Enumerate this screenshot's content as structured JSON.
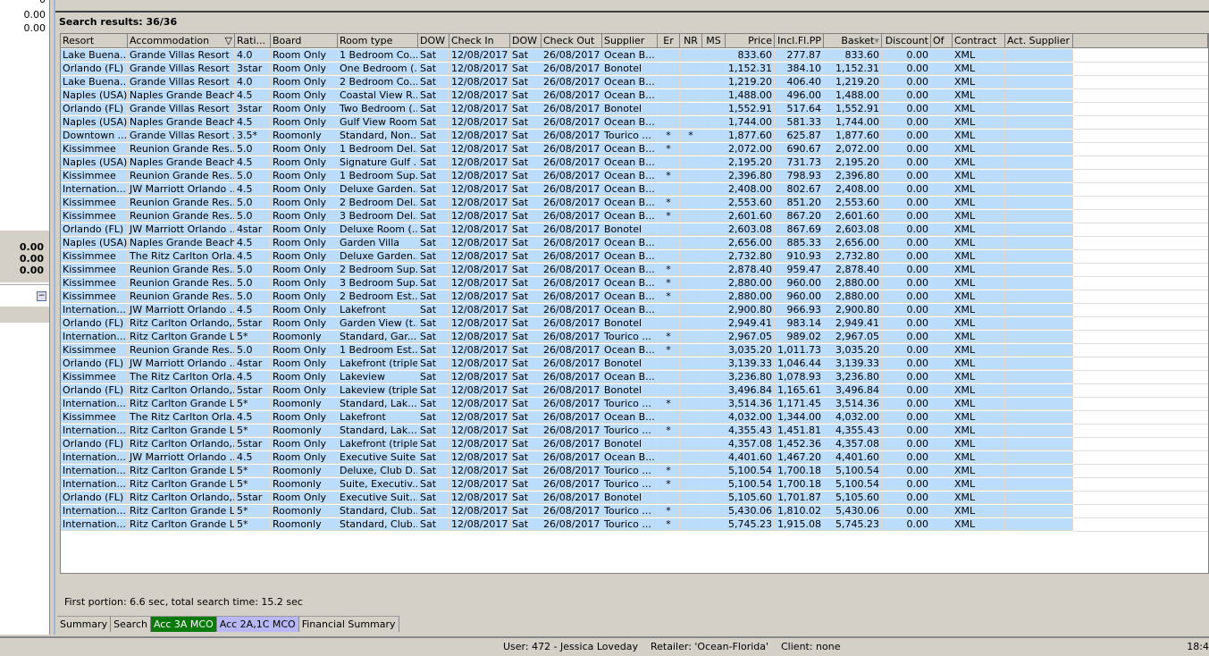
{
  "left_panel": {
    "top_values": [
      "0",
      "0.00",
      "0.00"
    ],
    "totals": [
      "0.00",
      "0.00",
      "0.00"
    ]
  },
  "results_title": "Search results: 36/36",
  "columns": [
    "Resort",
    "Accommodation",
    "Rati...",
    "Board",
    "Room type",
    "DOW",
    "Check In",
    "DOW",
    "Check Out",
    "Supplier",
    "Er",
    "NR",
    "MS",
    "Price",
    "Incl.Fl.PP",
    "Basket",
    "Discount",
    "Of",
    "Contract",
    "Act. Supplier"
  ],
  "rows": [
    [
      "Lake Buena...",
      "Grande Villas Resort",
      "4.0",
      "Room Only",
      "1 Bedroom Co...",
      "Sat",
      "12/08/2017",
      "Sat",
      "26/08/2017",
      "Ocean B...",
      "",
      "",
      "",
      "833.60",
      "277.87",
      "833.60",
      "0.00",
      "",
      "XML",
      ""
    ],
    [
      "Orlando (FL)",
      "Grande Villas Resort",
      "3star",
      "Room Only",
      "One Bedroom (...",
      "Sat",
      "12/08/2017",
      "Sat",
      "26/08/2017",
      "Bonotel",
      "",
      "",
      "",
      "1,152.31",
      "384.10",
      "1,152.31",
      "0.00",
      "",
      "XML",
      ""
    ],
    [
      "Lake Buena...",
      "Grande Villas Resort",
      "4.0",
      "Room Only",
      "2 Bedroom Co...",
      "Sat",
      "12/08/2017",
      "Sat",
      "26/08/2017",
      "Ocean B...",
      "",
      "",
      "",
      "1,219.20",
      "406.40",
      "1,219.20",
      "0.00",
      "",
      "XML",
      ""
    ],
    [
      "Naples (USA)",
      "Naples Grande Beach...",
      "4.5",
      "Room Only",
      "Coastal View R...",
      "Sat",
      "12/08/2017",
      "Sat",
      "26/08/2017",
      "Ocean B...",
      "",
      "",
      "",
      "1,488.00",
      "496.00",
      "1,488.00",
      "0.00",
      "",
      "XML",
      ""
    ],
    [
      "Orlando (FL)",
      "Grande Villas Resort",
      "3star",
      "Room Only",
      "Two Bedroom (...",
      "Sat",
      "12/08/2017",
      "Sat",
      "26/08/2017",
      "Bonotel",
      "",
      "",
      "",
      "1,552.91",
      "517.64",
      "1,552.91",
      "0.00",
      "",
      "XML",
      ""
    ],
    [
      "Naples (USA)",
      "Naples Grande Beach...",
      "4.5",
      "Room Only",
      "Gulf View Room",
      "Sat",
      "12/08/2017",
      "Sat",
      "26/08/2017",
      "Ocean B...",
      "",
      "",
      "",
      "1,744.00",
      "581.33",
      "1,744.00",
      "0.00",
      "",
      "XML",
      ""
    ],
    [
      "Downtown ...",
      "Grande Villas Resort ...",
      "3.5*",
      "Roomonly",
      "Standard, Non...",
      "Sat",
      "12/08/2017",
      "Sat",
      "26/08/2017",
      "Tourico ...",
      "*",
      "*",
      "",
      "1,877.60",
      "625.87",
      "1,877.60",
      "0.00",
      "",
      "XML",
      ""
    ],
    [
      "Kissimmee",
      "Reunion Grande Res...",
      "5.0",
      "Room Only",
      "1 Bedroom Del...",
      "Sat",
      "12/08/2017",
      "Sat",
      "26/08/2017",
      "Ocean B...",
      "*",
      "",
      "",
      "2,072.00",
      "690.67",
      "2,072.00",
      "0.00",
      "",
      "XML",
      ""
    ],
    [
      "Naples (USA)",
      "Naples Grande Beach...",
      "4.5",
      "Room Only",
      "Signature Gulf ...",
      "Sat",
      "12/08/2017",
      "Sat",
      "26/08/2017",
      "Ocean B...",
      "",
      "",
      "",
      "2,195.20",
      "731.73",
      "2,195.20",
      "0.00",
      "",
      "XML",
      ""
    ],
    [
      "Kissimmee",
      "Reunion Grande Res...",
      "5.0",
      "Room Only",
      "1 Bedroom Sup...",
      "Sat",
      "12/08/2017",
      "Sat",
      "26/08/2017",
      "Ocean B...",
      "*",
      "",
      "",
      "2,396.80",
      "798.93",
      "2,396.80",
      "0.00",
      "",
      "XML",
      ""
    ],
    [
      "Internation...",
      "JW Marriott Orlando ...",
      "4.5",
      "Room Only",
      "Deluxe Garden...",
      "Sat",
      "12/08/2017",
      "Sat",
      "26/08/2017",
      "Ocean B...",
      "",
      "",
      "",
      "2,408.00",
      "802.67",
      "2,408.00",
      "0.00",
      "",
      "XML",
      ""
    ],
    [
      "Kissimmee",
      "Reunion Grande Res...",
      "5.0",
      "Room Only",
      "2 Bedroom Del...",
      "Sat",
      "12/08/2017",
      "Sat",
      "26/08/2017",
      "Ocean B...",
      "*",
      "",
      "",
      "2,553.60",
      "851.20",
      "2,553.60",
      "0.00",
      "",
      "XML",
      ""
    ],
    [
      "Kissimmee",
      "Reunion Grande Res...",
      "5.0",
      "Room Only",
      "3 Bedroom Del...",
      "Sat",
      "12/08/2017",
      "Sat",
      "26/08/2017",
      "Ocean B...",
      "*",
      "",
      "",
      "2,601.60",
      "867.20",
      "2,601.60",
      "0.00",
      "",
      "XML",
      ""
    ],
    [
      "Orlando (FL)",
      "JW Marriott Orlando ...",
      "4star",
      "Room Only",
      "Deluxe Room (...",
      "Sat",
      "12/08/2017",
      "Sat",
      "26/08/2017",
      "Bonotel",
      "",
      "",
      "",
      "2,603.08",
      "867.69",
      "2,603.08",
      "0.00",
      "",
      "XML",
      ""
    ],
    [
      "Naples (USA)",
      "Naples Grande Beach...",
      "4.5",
      "Room Only",
      "Garden Villa",
      "Sat",
      "12/08/2017",
      "Sat",
      "26/08/2017",
      "Ocean B...",
      "",
      "",
      "",
      "2,656.00",
      "885.33",
      "2,656.00",
      "0.00",
      "",
      "XML",
      ""
    ],
    [
      "Kissimmee",
      "The Ritz Carlton Orla...",
      "4.5",
      "Room Only",
      "Deluxe Garden...",
      "Sat",
      "12/08/2017",
      "Sat",
      "26/08/2017",
      "Ocean B...",
      "",
      "",
      "",
      "2,732.80",
      "910.93",
      "2,732.80",
      "0.00",
      "",
      "XML",
      ""
    ],
    [
      "Kissimmee",
      "Reunion Grande Res...",
      "5.0",
      "Room Only",
      "2 Bedroom Sup...",
      "Sat",
      "12/08/2017",
      "Sat",
      "26/08/2017",
      "Ocean B...",
      "*",
      "",
      "",
      "2,878.40",
      "959.47",
      "2,878.40",
      "0.00",
      "",
      "XML",
      ""
    ],
    [
      "Kissimmee",
      "Reunion Grande Res...",
      "5.0",
      "Room Only",
      "3 Bedroom Sup...",
      "Sat",
      "12/08/2017",
      "Sat",
      "26/08/2017",
      "Ocean B...",
      "*",
      "",
      "",
      "2,880.00",
      "960.00",
      "2,880.00",
      "0.00",
      "",
      "XML",
      ""
    ],
    [
      "Kissimmee",
      "Reunion Grande Res...",
      "5.0",
      "Room Only",
      "2 Bedroom Est...",
      "Sat",
      "12/08/2017",
      "Sat",
      "26/08/2017",
      "Ocean B...",
      "*",
      "",
      "",
      "2,880.00",
      "960.00",
      "2,880.00",
      "0.00",
      "",
      "XML",
      ""
    ],
    [
      "Internation...",
      "JW Marriott Orlando ...",
      "4.5",
      "Room Only",
      "Lakefront",
      "Sat",
      "12/08/2017",
      "Sat",
      "26/08/2017",
      "Ocean B...",
      "",
      "",
      "",
      "2,900.80",
      "966.93",
      "2,900.80",
      "0.00",
      "",
      "XML",
      ""
    ],
    [
      "Orlando (FL)",
      "Ritz Carlton Orlando,...",
      "5star",
      "Room Only",
      "Garden View (t...",
      "Sat",
      "12/08/2017",
      "Sat",
      "26/08/2017",
      "Bonotel",
      "",
      "",
      "",
      "2,949.41",
      "983.14",
      "2,949.41",
      "0.00",
      "",
      "XML",
      ""
    ],
    [
      "Internation...",
      "Ritz Carlton Grande L...",
      "5*",
      "Roomonly",
      "Standard, Gar...",
      "Sat",
      "12/08/2017",
      "Sat",
      "26/08/2017",
      "Tourico ...",
      "*",
      "",
      "",
      "2,967.05",
      "989.02",
      "2,967.05",
      "0.00",
      "",
      "XML",
      ""
    ],
    [
      "Kissimmee",
      "Reunion Grande Res...",
      "5.0",
      "Room Only",
      "1 Bedroom Est...",
      "Sat",
      "12/08/2017",
      "Sat",
      "26/08/2017",
      "Ocean B...",
      "*",
      "",
      "",
      "3,035.20",
      "1,011.73",
      "3,035.20",
      "0.00",
      "",
      "XML",
      ""
    ],
    [
      "Orlando (FL)",
      "JW Marriott Orlando ...",
      "4star",
      "Room Only",
      "Lakefront (triple )",
      "Sat",
      "12/08/2017",
      "Sat",
      "26/08/2017",
      "Bonotel",
      "",
      "",
      "",
      "3,139.33",
      "1,046.44",
      "3,139.33",
      "0.00",
      "",
      "XML",
      ""
    ],
    [
      "Kissimmee",
      "The Ritz Carlton Orla...",
      "4.5",
      "Room Only",
      "Lakeview",
      "Sat",
      "12/08/2017",
      "Sat",
      "26/08/2017",
      "Ocean B...",
      "",
      "",
      "",
      "3,236.80",
      "1,078.93",
      "3,236.80",
      "0.00",
      "",
      "XML",
      ""
    ],
    [
      "Orlando (FL)",
      "Ritz Carlton Orlando,...",
      "5star",
      "Room Only",
      "Lakeview (triple )",
      "Sat",
      "12/08/2017",
      "Sat",
      "26/08/2017",
      "Bonotel",
      "",
      "",
      "",
      "3,496.84",
      "1,165.61",
      "3,496.84",
      "0.00",
      "",
      "XML",
      ""
    ],
    [
      "Internation...",
      "Ritz Carlton Grande L...",
      "5*",
      "Roomonly",
      "Standard, Lak...",
      "Sat",
      "12/08/2017",
      "Sat",
      "26/08/2017",
      "Tourico ...",
      "*",
      "",
      "",
      "3,514.36",
      "1,171.45",
      "3,514.36",
      "0.00",
      "",
      "XML",
      ""
    ],
    [
      "Kissimmee",
      "The Ritz Carlton Orla...",
      "4.5",
      "Room Only",
      "Lakefront",
      "Sat",
      "12/08/2017",
      "Sat",
      "26/08/2017",
      "Ocean B...",
      "",
      "",
      "",
      "4,032.00",
      "1,344.00",
      "4,032.00",
      "0.00",
      "",
      "XML",
      ""
    ],
    [
      "Internation...",
      "Ritz Carlton Grande L...",
      "5*",
      "Roomonly",
      "Standard, Lak...",
      "Sat",
      "12/08/2017",
      "Sat",
      "26/08/2017",
      "Tourico ...",
      "*",
      "",
      "",
      "4,355.43",
      "1,451.81",
      "4,355.43",
      "0.00",
      "",
      "XML",
      ""
    ],
    [
      "Orlando (FL)",
      "Ritz Carlton Orlando,...",
      "5star",
      "Room Only",
      "Lakefront (triple )",
      "Sat",
      "12/08/2017",
      "Sat",
      "26/08/2017",
      "Bonotel",
      "",
      "",
      "",
      "4,357.08",
      "1,452.36",
      "4,357.08",
      "0.00",
      "",
      "XML",
      ""
    ],
    [
      "Internation...",
      "JW Marriott Orlando ...",
      "4.5",
      "Room Only",
      "Executive Suite",
      "Sat",
      "12/08/2017",
      "Sat",
      "26/08/2017",
      "Ocean B...",
      "",
      "",
      "",
      "4,401.60",
      "1,467.20",
      "4,401.60",
      "0.00",
      "",
      "XML",
      ""
    ],
    [
      "Internation...",
      "Ritz Carlton Grande L...",
      "5*",
      "Roomonly",
      "Deluxe, Club D...",
      "Sat",
      "12/08/2017",
      "Sat",
      "26/08/2017",
      "Tourico ...",
      "*",
      "",
      "",
      "5,100.54",
      "1,700.18",
      "5,100.54",
      "0.00",
      "",
      "XML",
      ""
    ],
    [
      "Internation...",
      "Ritz Carlton Grande L...",
      "5*",
      "Roomonly",
      "Suite, Executiv...",
      "Sat",
      "12/08/2017",
      "Sat",
      "26/08/2017",
      "Tourico ...",
      "*",
      "",
      "",
      "5,100.54",
      "1,700.18",
      "5,100.54",
      "0.00",
      "",
      "XML",
      ""
    ],
    [
      "Orlando (FL)",
      "Ritz Carlton Orlando,...",
      "5star",
      "Room Only",
      "Executive Suit...",
      "Sat",
      "12/08/2017",
      "Sat",
      "26/08/2017",
      "Bonotel",
      "",
      "",
      "",
      "5,105.60",
      "1,701.87",
      "5,105.60",
      "0.00",
      "",
      "XML",
      ""
    ],
    [
      "Internation...",
      "Ritz Carlton Grande L...",
      "5*",
      "Roomonly",
      "Standard, Club...",
      "Sat",
      "12/08/2017",
      "Sat",
      "26/08/2017",
      "Tourico ...",
      "*",
      "",
      "",
      "5,430.06",
      "1,810.02",
      "5,430.06",
      "0.00",
      "",
      "XML",
      ""
    ],
    [
      "Internation...",
      "Ritz Carlton Grande L...",
      "5*",
      "Roomonly",
      "Standard, Club...",
      "Sat",
      "12/08/2017",
      "Sat",
      "26/08/2017",
      "Tourico ...",
      "*",
      "",
      "",
      "5,745.23",
      "1,915.08",
      "5,745.23",
      "0.00",
      "",
      "XML",
      ""
    ]
  ],
  "timing": "First portion: 6.6 sec, total search time: 15.2 sec",
  "tabs": [
    {
      "label": "Summary",
      "bg": "#d4d0c8",
      "fg": "#000000"
    },
    {
      "label": "Search",
      "bg": "#d4d0c8",
      "fg": "#000000"
    },
    {
      "label": "Acc 3A MCO",
      "bg": "#0a7a0a",
      "fg": "#ffffff"
    },
    {
      "label": "Acc 2A,1C MCO",
      "bg": "#b8b8f8",
      "fg": "#000000"
    },
    {
      "label": "Financial Summary",
      "bg": "#d4d0c8",
      "fg": "#000000"
    }
  ],
  "status": {
    "user": "User: 472 - Jessica Loveday    Retailer: 'Ocean-Florida'    Client: none",
    "clock": "18:4"
  }
}
